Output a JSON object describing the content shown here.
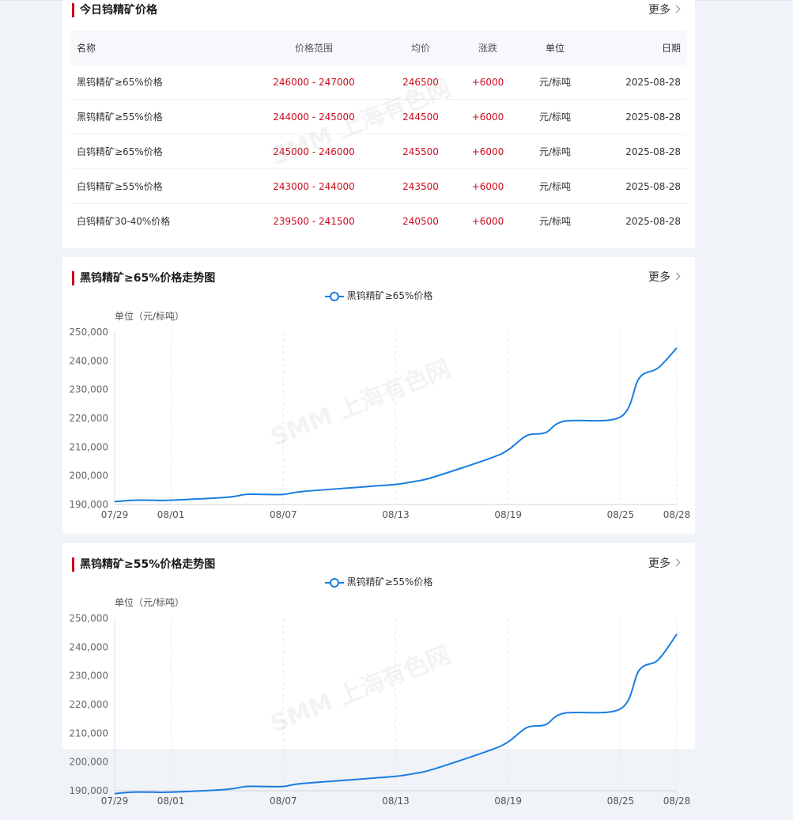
{
  "price_section": {
    "title": "今日钨精矿价格",
    "more_label": "更多",
    "headers": {
      "name": "名称",
      "range": "价格范围",
      "avg": "均价",
      "change": "涨跌",
      "unit": "单位",
      "date": "日期"
    },
    "rows": [
      {
        "name": "黑钨精矿≥65%价格",
        "range": "246000 - 247000",
        "avg": "246500",
        "change": "+6000",
        "unit": "元/标吨",
        "date": "2025-08-28"
      },
      {
        "name": "黑钨精矿≥55%价格",
        "range": "244000 - 245000",
        "avg": "244500",
        "change": "+6000",
        "unit": "元/标吨",
        "date": "2025-08-28"
      },
      {
        "name": "白钨精矿≥65%价格",
        "range": "245000 - 246000",
        "avg": "245500",
        "change": "+6000",
        "unit": "元/标吨",
        "date": "2025-08-28"
      },
      {
        "name": "白钨精矿≥55%价格",
        "range": "243000 - 244000",
        "avg": "243500",
        "change": "+6000",
        "unit": "元/标吨",
        "date": "2025-08-28"
      },
      {
        "name": "白钨精矿30-40%价格",
        "range": "239500 - 241500",
        "avg": "240500",
        "change": "+6000",
        "unit": "元/标吨",
        "date": "2025-08-28"
      }
    ]
  },
  "watermark": "SMM 上海有色网",
  "colors": {
    "accent": "#cc0d1f",
    "line": "#1a7de0",
    "up": "#cc0d1f"
  },
  "chart_data": [
    {
      "type": "line",
      "title": "黑钨精矿≥65%价格走势图",
      "more_label": "更多",
      "legend": "黑钨精矿≥65%价格",
      "unit_label": "单位（元/标吨）",
      "ylim": [
        190000,
        250000
      ],
      "yticks": [
        "190,000",
        "200,000",
        "210,000",
        "220,000",
        "230,000",
        "240,000",
        "250,000"
      ],
      "xticks": [
        "07/29",
        "08/01",
        "08/07",
        "08/13",
        "08/19",
        "08/25",
        "08/28"
      ],
      "grid": "vertical-dashed",
      "series": [
        {
          "name": "黑钨精矿≥65%价格",
          "x": [
            "07/29",
            "07/30",
            "07/31",
            "08/01",
            "08/04",
            "08/05",
            "08/06",
            "08/07",
            "08/08",
            "08/11",
            "08/12",
            "08/13",
            "08/14",
            "08/15",
            "08/18",
            "08/19",
            "08/20",
            "08/21",
            "08/22",
            "08/25",
            "08/26",
            "08/27",
            "08/28"
          ],
          "values": [
            191000,
            191500,
            191500,
            191500,
            192500,
            193500,
            193500,
            193500,
            194500,
            196000,
            196500,
            197000,
            198000,
            199500,
            206000,
            209000,
            214000,
            215000,
            219000,
            220500,
            234000,
            237500,
            244500
          ]
        }
      ]
    },
    {
      "type": "line",
      "title": "黑钨精矿≥55%价格走势图",
      "more_label": "更多",
      "legend": "黑钨精矿≥55%价格",
      "unit_label": "单位（元/标吨）",
      "ylim": [
        190000,
        250000
      ],
      "yticks": [
        "190,000",
        "200,000",
        "210,000",
        "220,000",
        "230,000",
        "240,000",
        "250,000"
      ],
      "xticks": [
        "07/29",
        "08/01",
        "08/07",
        "08/13",
        "08/19",
        "08/25",
        "08/28"
      ],
      "grid": "vertical-dashed",
      "series": [
        {
          "name": "黑钨精矿≥55%价格",
          "x": [
            "07/29",
            "07/30",
            "07/31",
            "08/01",
            "08/04",
            "08/05",
            "08/06",
            "08/07",
            "08/08",
            "08/11",
            "08/12",
            "08/13",
            "08/14",
            "08/15",
            "08/18",
            "08/19",
            "08/20",
            "08/21",
            "08/22",
            "08/25",
            "08/26",
            "08/27",
            "08/28"
          ],
          "values": [
            189000,
            189500,
            189500,
            189500,
            190500,
            191500,
            191500,
            191500,
            192500,
            194000,
            194500,
            195000,
            196000,
            197500,
            204000,
            207000,
            212000,
            213000,
            217000,
            218500,
            232000,
            235500,
            244500
          ]
        }
      ]
    }
  ]
}
